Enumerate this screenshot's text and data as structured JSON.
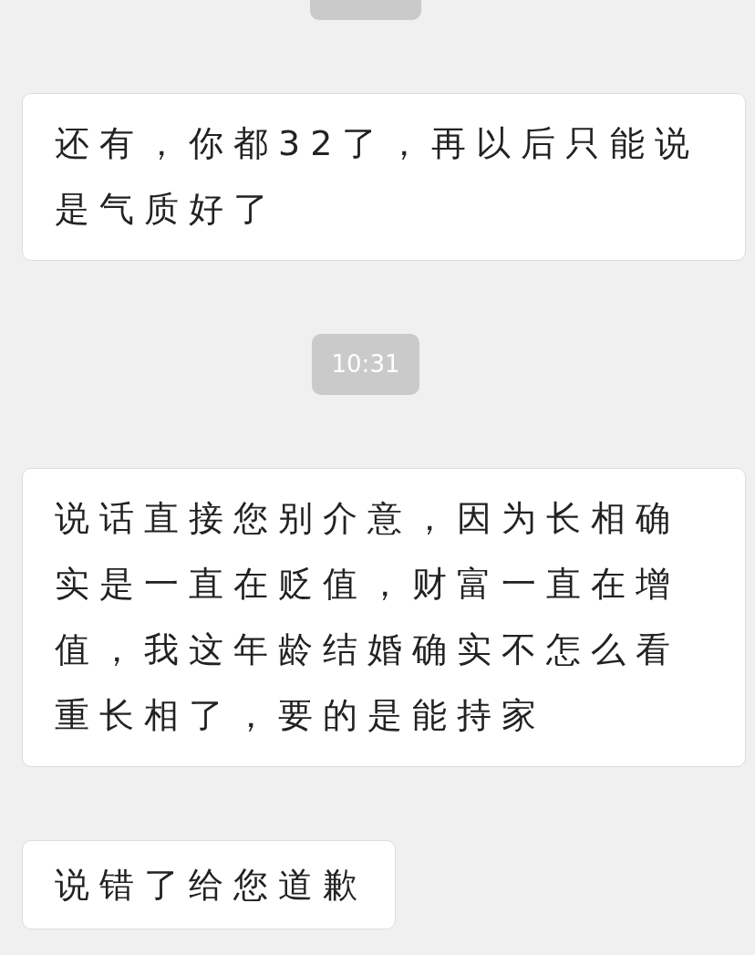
{
  "messages": [
    {
      "kind": "time_cut"
    },
    {
      "kind": "bubble",
      "text": "还有，你都32了，再以后只能说是气质好了"
    },
    {
      "kind": "time",
      "text": "10:31"
    },
    {
      "kind": "bubble",
      "text": "说话直接您别介意，因为长相确实是一直在贬值，财富一直在增值，我这年龄结婚确实不怎么看重长相了，要的是能持家"
    },
    {
      "kind": "bubble",
      "text": "说错了给您道歉"
    }
  ]
}
